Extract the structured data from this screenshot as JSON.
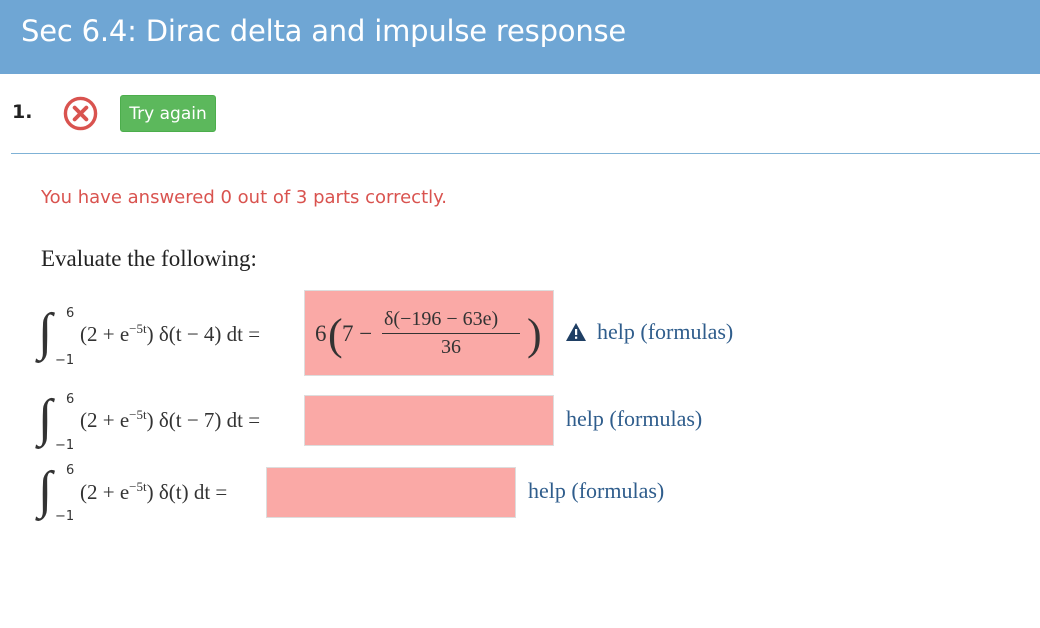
{
  "header": {
    "title": "Sec 6.4: Dirac delta and impulse response"
  },
  "question": {
    "number": "1.",
    "status_icon": "incorrect-x-icon",
    "try_again_label": "Try again"
  },
  "status_message": "You have answered 0 out of 3 parts correctly.",
  "prompt": "Evaluate the following:",
  "parts": [
    {
      "lower": "−1",
      "upper": "6",
      "integrand": "(2 + e",
      "exponent": "−5t",
      "rest": ") δ(t − 4) dt =",
      "answer": {
        "coef": "6",
        "lead": "7 −",
        "numerator": "δ(−196 − 63e)",
        "denominator": "36"
      },
      "warning_icon": "warning-triangle-icon",
      "help": "help (formulas)"
    },
    {
      "lower": "−1",
      "upper": "6",
      "integrand": "(2 + e",
      "exponent": "−5t",
      "rest": ") δ(t − 7) dt =",
      "answer_value": "",
      "help": "help (formulas)"
    },
    {
      "lower": "−1",
      "upper": "6",
      "integrand": "(2 + e",
      "exponent": "−5t",
      "rest": ") δ(t) dt =",
      "answer_value": "",
      "help": "help (formulas)"
    }
  ],
  "colors": {
    "header_bg": "#6fa6d4",
    "try_again_bg": "#5cb85c",
    "incorrect_red": "#d9534f",
    "answer_incorrect_bg": "#faa9a6",
    "help_link": "#2f5d8c"
  }
}
